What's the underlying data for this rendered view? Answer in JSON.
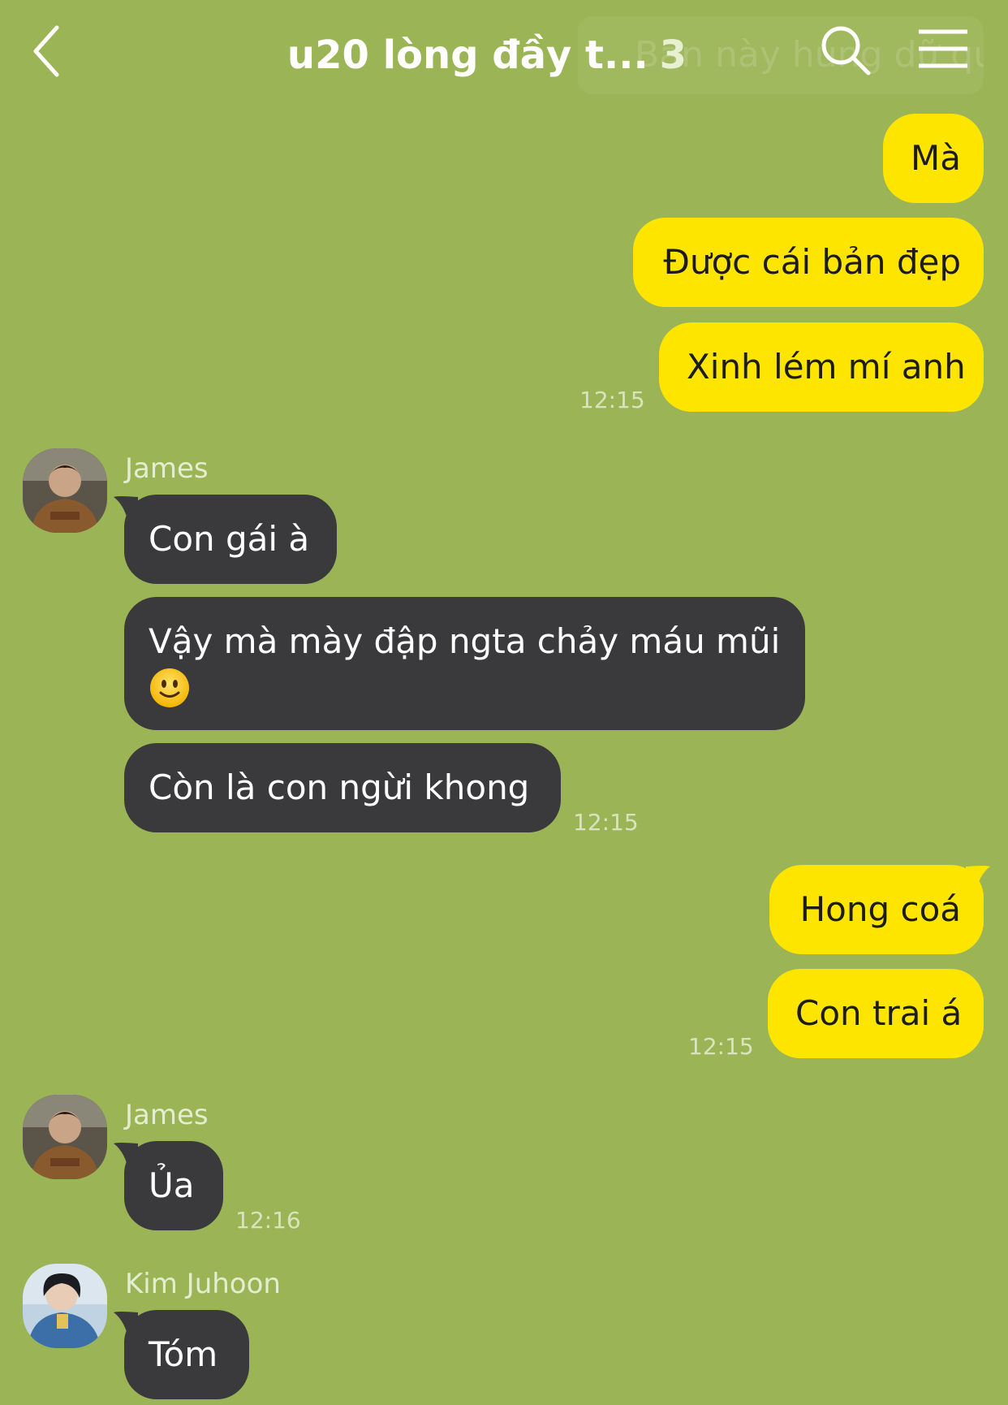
{
  "header": {
    "title": "u20 lòng đầy t...",
    "member_count": "3",
    "ghost_search_text": "Ban này hung dữ quá"
  },
  "colors": {
    "background": "#9bb556",
    "my_bubble": "#fee500",
    "their_bubble": "#3a3a3c"
  },
  "messages": {
    "m1": "Mà",
    "m2": "Được cái bản đẹp",
    "m3": "Xinh lém mí anh",
    "m3_time": "12:15",
    "james1_name": "James",
    "j1": "Con gái à",
    "j2": "Vậy mà mày đập ngta chảy máu mũi",
    "j2_emoji": "🙂",
    "j3": "Còn là con ngừi khong",
    "j3_time": "12:15",
    "m4": "Hong coá",
    "m5": "Con trai á",
    "m5_time": "12:15",
    "james2_name": "James",
    "j4": "Ủa",
    "j4_time": "12:16",
    "kim_name": "Kim Juhoon",
    "k1": "Tóm"
  },
  "icons": {
    "back": "chevron-left-icon",
    "search": "search-icon",
    "menu": "hamburger-menu-icon",
    "emoji": "slightly-smiling-face-icon"
  }
}
